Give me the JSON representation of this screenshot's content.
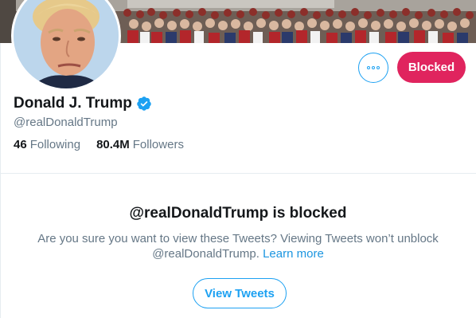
{
  "profile": {
    "display_name": "Donald J. Trump",
    "handle": "@realDonaldTrump",
    "verified": true,
    "avatar_icon": "profile-photo",
    "banner_icon": "crowd-rally-banner"
  },
  "actions": {
    "more_icon": "more-options-icon",
    "blocked_label": "Blocked"
  },
  "stats": [
    {
      "value": "46",
      "label": "Following"
    },
    {
      "value": "80.4M",
      "label": "Followers"
    }
  ],
  "blocked_notice": {
    "title": "@realDonaldTrump is blocked",
    "message": "Are you sure you want to view these Tweets? Viewing Tweets won’t unblock @realDonaldTrump.",
    "learn_more": "Learn more",
    "view_button": "View Tweets"
  },
  "colors": {
    "accent": "#1da1f2",
    "blocked": "#e0245e",
    "text_primary": "#14171a",
    "text_secondary": "#657786"
  }
}
